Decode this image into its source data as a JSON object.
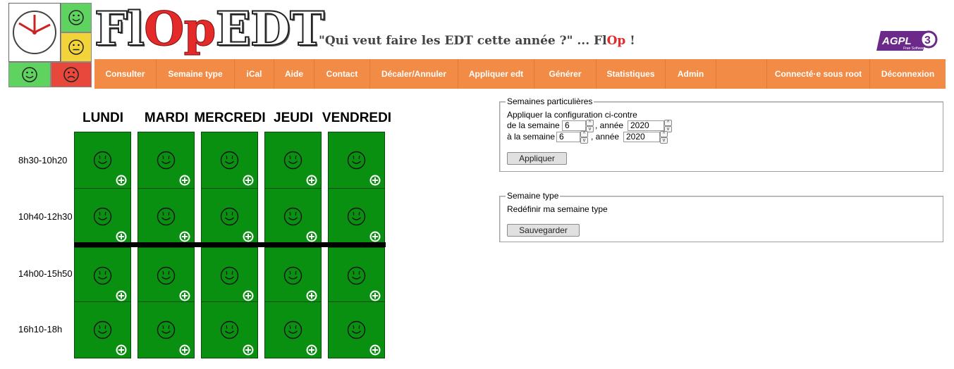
{
  "app": {
    "brand": {
      "part1": "Fl",
      "part2": "Op",
      "part3": "EDT"
    },
    "tagline": {
      "text": "\"Qui veut faire les EDT cette année ?\" ... Fl",
      "highlight": "Op",
      "suffix": " !"
    },
    "license_badge": "AGPL",
    "license_version": "3",
    "license_note": "Free Software",
    "colors": {
      "nav": "#f28b45",
      "cell": "#0a9010",
      "accent": "#e52a2a"
    }
  },
  "nav": {
    "items": [
      {
        "label": "Consulter"
      },
      {
        "label": "Semaine type"
      },
      {
        "label": "iCal"
      },
      {
        "label": "Aide"
      },
      {
        "label": "Contact"
      },
      {
        "label": "Décaler/Annuler"
      },
      {
        "label": "Appliquer edt"
      },
      {
        "label": "Générer"
      },
      {
        "label": "Statistiques"
      },
      {
        "label": "Admin"
      }
    ],
    "right": [
      {
        "label": "Connecté·e sous root"
      },
      {
        "label": "Déconnexion"
      }
    ]
  },
  "schedule": {
    "days": [
      "LUNDI",
      "MARDI",
      "MERCREDI",
      "JEUDI",
      "VENDREDI"
    ],
    "slots": [
      "8h30-10h20",
      "10h40-12h30",
      "14h00-15h50",
      "16h10-18h"
    ],
    "cell_icon": "smiley-icon",
    "add_icon": "plus-circle-icon"
  },
  "special_weeks": {
    "legend": "Semaines particulières",
    "intro": "Appliquer la configuration ci-contre",
    "from_label": "de la semaine",
    "from_week": "6",
    "from_year_label": ", année",
    "from_year": "2020",
    "to_label": "à la semaine",
    "to_week": "6",
    "to_year_label": ", année",
    "to_year": "2020",
    "apply_button": "Appliquer"
  },
  "type_week": {
    "legend": "Semaine type",
    "description": "Redéfinir ma semaine type",
    "save_button": "Sauvegarder"
  }
}
